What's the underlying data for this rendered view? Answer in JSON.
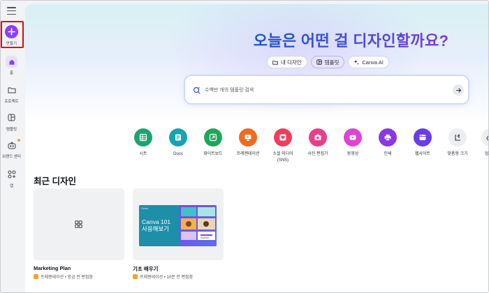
{
  "sidebar": {
    "items": [
      {
        "label": "만들기",
        "icon": "plus-icon"
      },
      {
        "label": "홈",
        "icon": "home-icon"
      },
      {
        "label": "프로젝트",
        "icon": "folder-icon"
      },
      {
        "label": "템플릿",
        "icon": "template-icon"
      },
      {
        "label": "브랜드 센터",
        "icon": "brand-icon"
      },
      {
        "label": "앱",
        "icon": "apps-icon"
      }
    ]
  },
  "hero": {
    "title": "오늘은 어떤 걸 디자인할까요?",
    "tabs": [
      {
        "label": "내 디자인",
        "icon": "folder-icon"
      },
      {
        "label": "템플릿",
        "icon": "template-icon"
      },
      {
        "label": "Canva AI",
        "icon": "sparkle-icon"
      }
    ],
    "search": {
      "placeholder": "수백만 개의 템플릿 검색"
    }
  },
  "categories": [
    {
      "label": "시트",
      "color": "#1aa56f"
    },
    {
      "label": "Docs",
      "color": "#15a3b5"
    },
    {
      "label": "화이트보드",
      "color": "#1ea65a"
    },
    {
      "label": "프레젠테이션",
      "color": "#f06b1c"
    },
    {
      "label": "소셜 미디어",
      "sub": "(SNS)",
      "color": "#ef3d5b"
    },
    {
      "label": "사진 편집기",
      "color": "#ec3d8a"
    },
    {
      "label": "동영상",
      "color": "#e041d6"
    },
    {
      "label": "인쇄",
      "color": "#8a37e6"
    },
    {
      "label": "웹사이트",
      "color": "#6b3ce8"
    },
    {
      "label": "맞춤형 크기",
      "color": "#eceef1"
    },
    {
      "label": "업로드",
      "color": "#eceef1"
    }
  ],
  "recent": {
    "title": "최근 디자인",
    "cards": [
      {
        "title": "Marketing Plan",
        "meta": "프레젠테이션 • 방금 전 편집함"
      },
      {
        "title": "기초 배우기",
        "meta": "프레젠테이션 • 10분 전 편집함",
        "thumb_brand": "Canva",
        "thumb_line1": "Canva 101",
        "thumb_line2": "사용해보기"
      }
    ]
  },
  "colors": {
    "accent": "#8b3dff",
    "highlight": "#e60012"
  }
}
